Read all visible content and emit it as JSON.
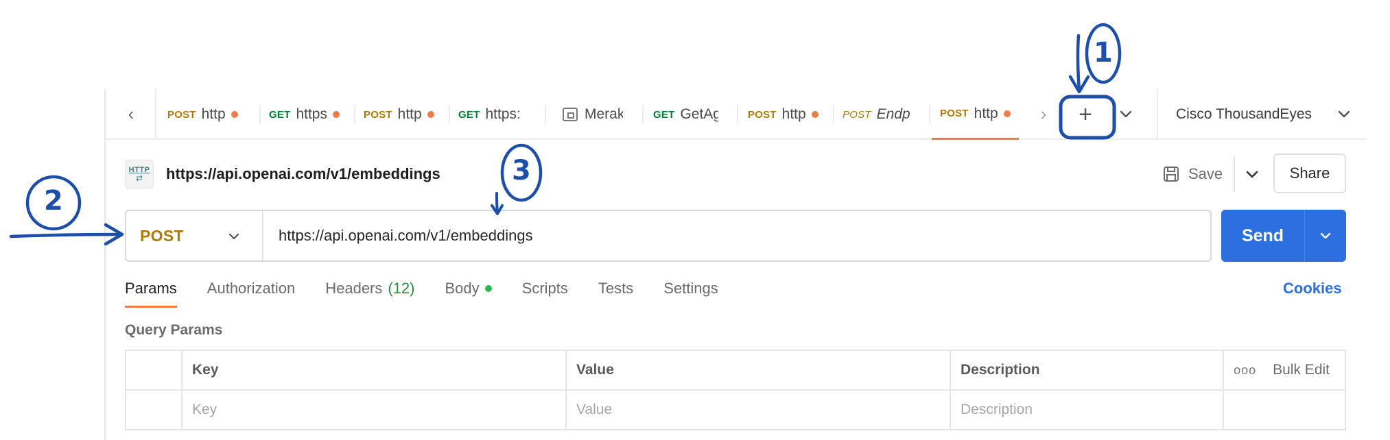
{
  "tabbar": {
    "tabs": [
      {
        "method": "POST",
        "name": "http",
        "unsaved": true,
        "italic": false,
        "active": false,
        "icon": null
      },
      {
        "method": "GET",
        "name": "https",
        "unsaved": true,
        "italic": false,
        "active": false,
        "icon": null
      },
      {
        "method": "POST",
        "name": "http",
        "unsaved": true,
        "italic": false,
        "active": false,
        "icon": null
      },
      {
        "method": "GET",
        "name": "https:",
        "unsaved": false,
        "italic": false,
        "active": false,
        "icon": null
      },
      {
        "method": "",
        "name": "Merak",
        "unsaved": false,
        "italic": false,
        "active": false,
        "icon": "document-icon"
      },
      {
        "method": "GET",
        "name": "GetAg",
        "unsaved": false,
        "italic": false,
        "active": false,
        "icon": null
      },
      {
        "method": "POST",
        "name": "http",
        "unsaved": true,
        "italic": false,
        "active": false,
        "icon": null
      },
      {
        "method": "POST",
        "name": "Endp",
        "unsaved": false,
        "italic": true,
        "active": false,
        "icon": null
      },
      {
        "method": "POST",
        "name": "http",
        "unsaved": true,
        "italic": false,
        "active": true,
        "icon": null
      }
    ],
    "new_tab_label": "+",
    "workspace": "Cisco ThousandEyes"
  },
  "request": {
    "title": "https://api.openai.com/v1/embeddings",
    "save_label": "Save",
    "share_label": "Share",
    "method": "POST",
    "url": "https://api.openai.com/v1/embeddings",
    "send_label": "Send"
  },
  "subtabs": {
    "params": "Params",
    "authorization": "Authorization",
    "headers": "Headers",
    "headers_count": "(12)",
    "body": "Body",
    "scripts": "Scripts",
    "tests": "Tests",
    "settings": "Settings",
    "cookies": "Cookies"
  },
  "query_params": {
    "section_label": "Query Params",
    "columns": {
      "key": "Key",
      "value": "Value",
      "description": "Description"
    },
    "bulk_edit": "Bulk Edit",
    "placeholders": {
      "key": "Key",
      "value": "Value",
      "description": "Description"
    }
  },
  "annotations": {
    "one": "1",
    "two": "2",
    "three": "3"
  },
  "colors": {
    "post": "#ad7a03",
    "get": "#007f31",
    "accent": "#ef7b45",
    "send": "#2b6fe0",
    "annotation": "#1d4fa8"
  }
}
